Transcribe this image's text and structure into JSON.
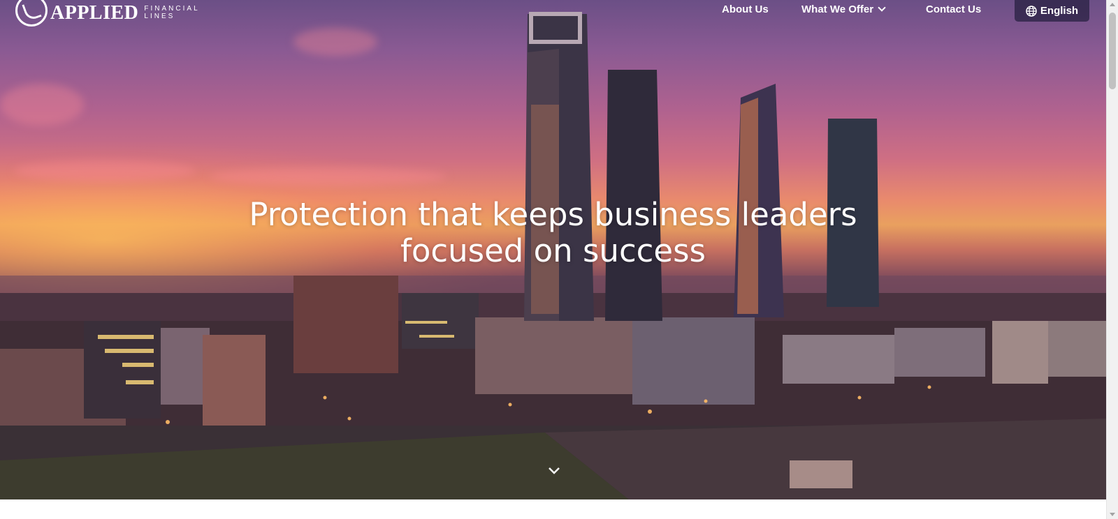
{
  "brand": {
    "name": "APPLIED",
    "sub_line1": "FINANCIAL",
    "sub_line2": "LINES"
  },
  "nav": {
    "about_label": "About Us",
    "offer_label": "What We Offer",
    "contact_label": "Contact Us",
    "language_label": "English"
  },
  "hero": {
    "headline_line1": "Protection that keeps business leaders",
    "headline_line2": "focused on success"
  },
  "icons": {
    "logo": "lion-head-logo-icon",
    "offer_dropdown": "chevron-down-icon",
    "language": "globe-icon",
    "scroll": "chevron-down-icon"
  },
  "colors": {
    "language_button_bg": "#28204a",
    "text": "#ffffff"
  }
}
